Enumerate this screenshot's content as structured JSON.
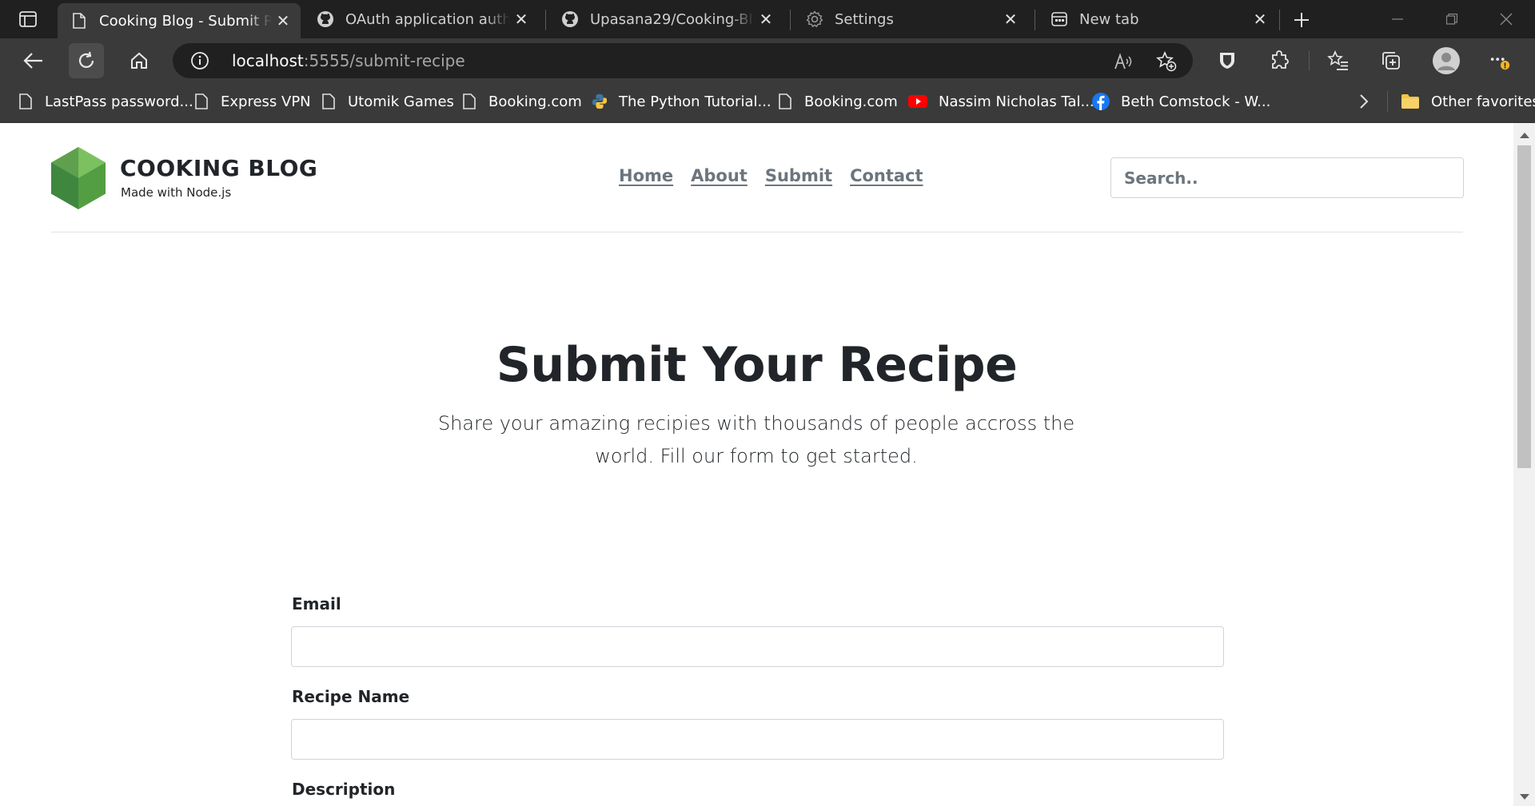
{
  "browser": {
    "tabs": [
      {
        "title": "Cooking Blog - Submit Recipe",
        "icon": "page-icon",
        "active": true
      },
      {
        "title": "OAuth application authorization",
        "icon": "github-icon",
        "active": false
      },
      {
        "title": "Upasana29/Cooking-Blog",
        "icon": "github-icon",
        "active": false
      },
      {
        "title": "Settings",
        "icon": "gear-icon",
        "active": false
      },
      {
        "title": "New tab",
        "icon": "newtab-icon",
        "active": false
      }
    ],
    "address": {
      "host": "localhost",
      "path": ":5555/submit-recipe"
    },
    "bookmarks": [
      {
        "label": "LastPass password...",
        "icon": "page-icon"
      },
      {
        "label": "Express VPN",
        "icon": "page-icon"
      },
      {
        "label": "Utomik Games",
        "icon": "page-icon"
      },
      {
        "label": "Booking.com",
        "icon": "page-icon"
      },
      {
        "label": "The Python Tutorial...",
        "icon": "python-icon"
      },
      {
        "label": "Booking.com",
        "icon": "page-icon"
      },
      {
        "label": "Nassim Nicholas Tal...",
        "icon": "youtube-icon"
      },
      {
        "label": "Beth Comstock - W...",
        "icon": "facebook-icon"
      }
    ],
    "other_favorites": "Other favorites"
  },
  "site": {
    "brand": "COOKING BLOG",
    "tagline": "Made with Node.js",
    "nav": [
      "Home",
      "About",
      "Submit",
      "Contact"
    ],
    "search_placeholder": "Search.."
  },
  "hero": {
    "title": "Submit Your Recipe",
    "lead": "Share your amazing recipies with thousands of people accross the world. Fill our form to get started."
  },
  "form": {
    "email_label": "Email",
    "email_value": "",
    "recipe_name_label": "Recipe Name",
    "recipe_name_value": "",
    "description_label": "Description"
  },
  "colors": {
    "chrome_dark": "#202020",
    "chrome_toolbar": "#3a3a3a",
    "logo_green": "#5fa04e",
    "nav_link": "#6c757d",
    "text": "#212529"
  }
}
